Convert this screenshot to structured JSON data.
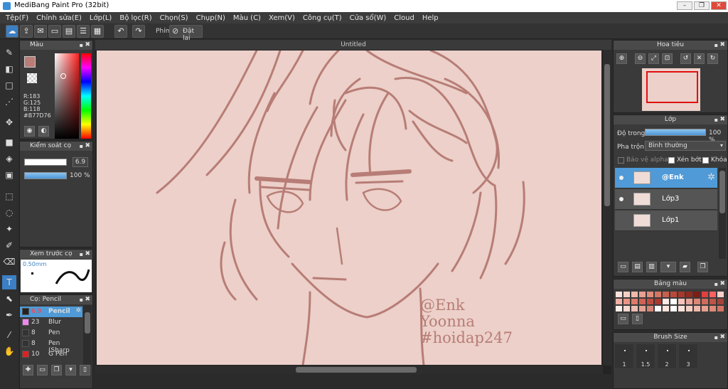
{
  "window": {
    "title": "MediBang Paint Pro (32bit)",
    "min": "–",
    "max": "❐",
    "close": "✕"
  },
  "menu": [
    "Tệp(F)",
    "Chỉnh sửa(E)",
    "Lớp(L)",
    "Bộ lọc(R)",
    "Chọn(S)",
    "Chụp(N)",
    "Màu (C)",
    "Xem(V)",
    "Công cụ(T)",
    "Cửa sổ(W)",
    "Cloud",
    "Help"
  ],
  "toolbar": {
    "shortcut_label": "Phím",
    "reset_label": "Đặt lại"
  },
  "color_panel": {
    "title": "Màu",
    "r": "R:183",
    "g": "G:125",
    "b": "B:118",
    "hex": "#B77D76",
    "fg_color": "#B77D76"
  },
  "brush_control": {
    "title": "Kiểm soát cọ",
    "size_value": "6.9",
    "opacity_value": "100 %"
  },
  "brush_preview": {
    "title": "Xem trước cọ",
    "size_label": "0.50mm"
  },
  "brush_list": {
    "title": "Cọ: Pencil",
    "items": [
      {
        "size": "6.9",
        "name": "Pencil",
        "color": "#222222"
      },
      {
        "size": "23",
        "name": "Blur",
        "color": "#ee88ee"
      },
      {
        "size": "8",
        "name": "Pen",
        "color": "#333333"
      },
      {
        "size": "8",
        "name": "Pen (Sharp",
        "color": "#333333"
      },
      {
        "size": "10",
        "name": "G Pen",
        "color": "#e02020"
      }
    ]
  },
  "canvas": {
    "tab_title": "Untitled",
    "bg_color": "#ecd0c9",
    "line_color": "#b77d76"
  },
  "artwork_text": [
    "@Enk",
    "Yoonna",
    "#hoidap247"
  ],
  "navigator": {
    "title": "Hoa tiêu"
  },
  "layers_panel": {
    "title": "Lớp",
    "opacity_label": "Độ trong",
    "opacity_value": "100 %",
    "blend_label": "Pha trộn",
    "blend_value": "Bình thường",
    "protect_alpha": "Bảo vệ alpha",
    "clipping": "Xén bớt",
    "lock": "Khóa",
    "layers": [
      "@Enk",
      "Lớp3",
      "Lớp1"
    ]
  },
  "palette_panel": {
    "title": "Bảng màu"
  },
  "brush_size_panel": {
    "title": "Brush Size",
    "sizes": [
      "1",
      "1.5",
      "2",
      "3"
    ]
  }
}
